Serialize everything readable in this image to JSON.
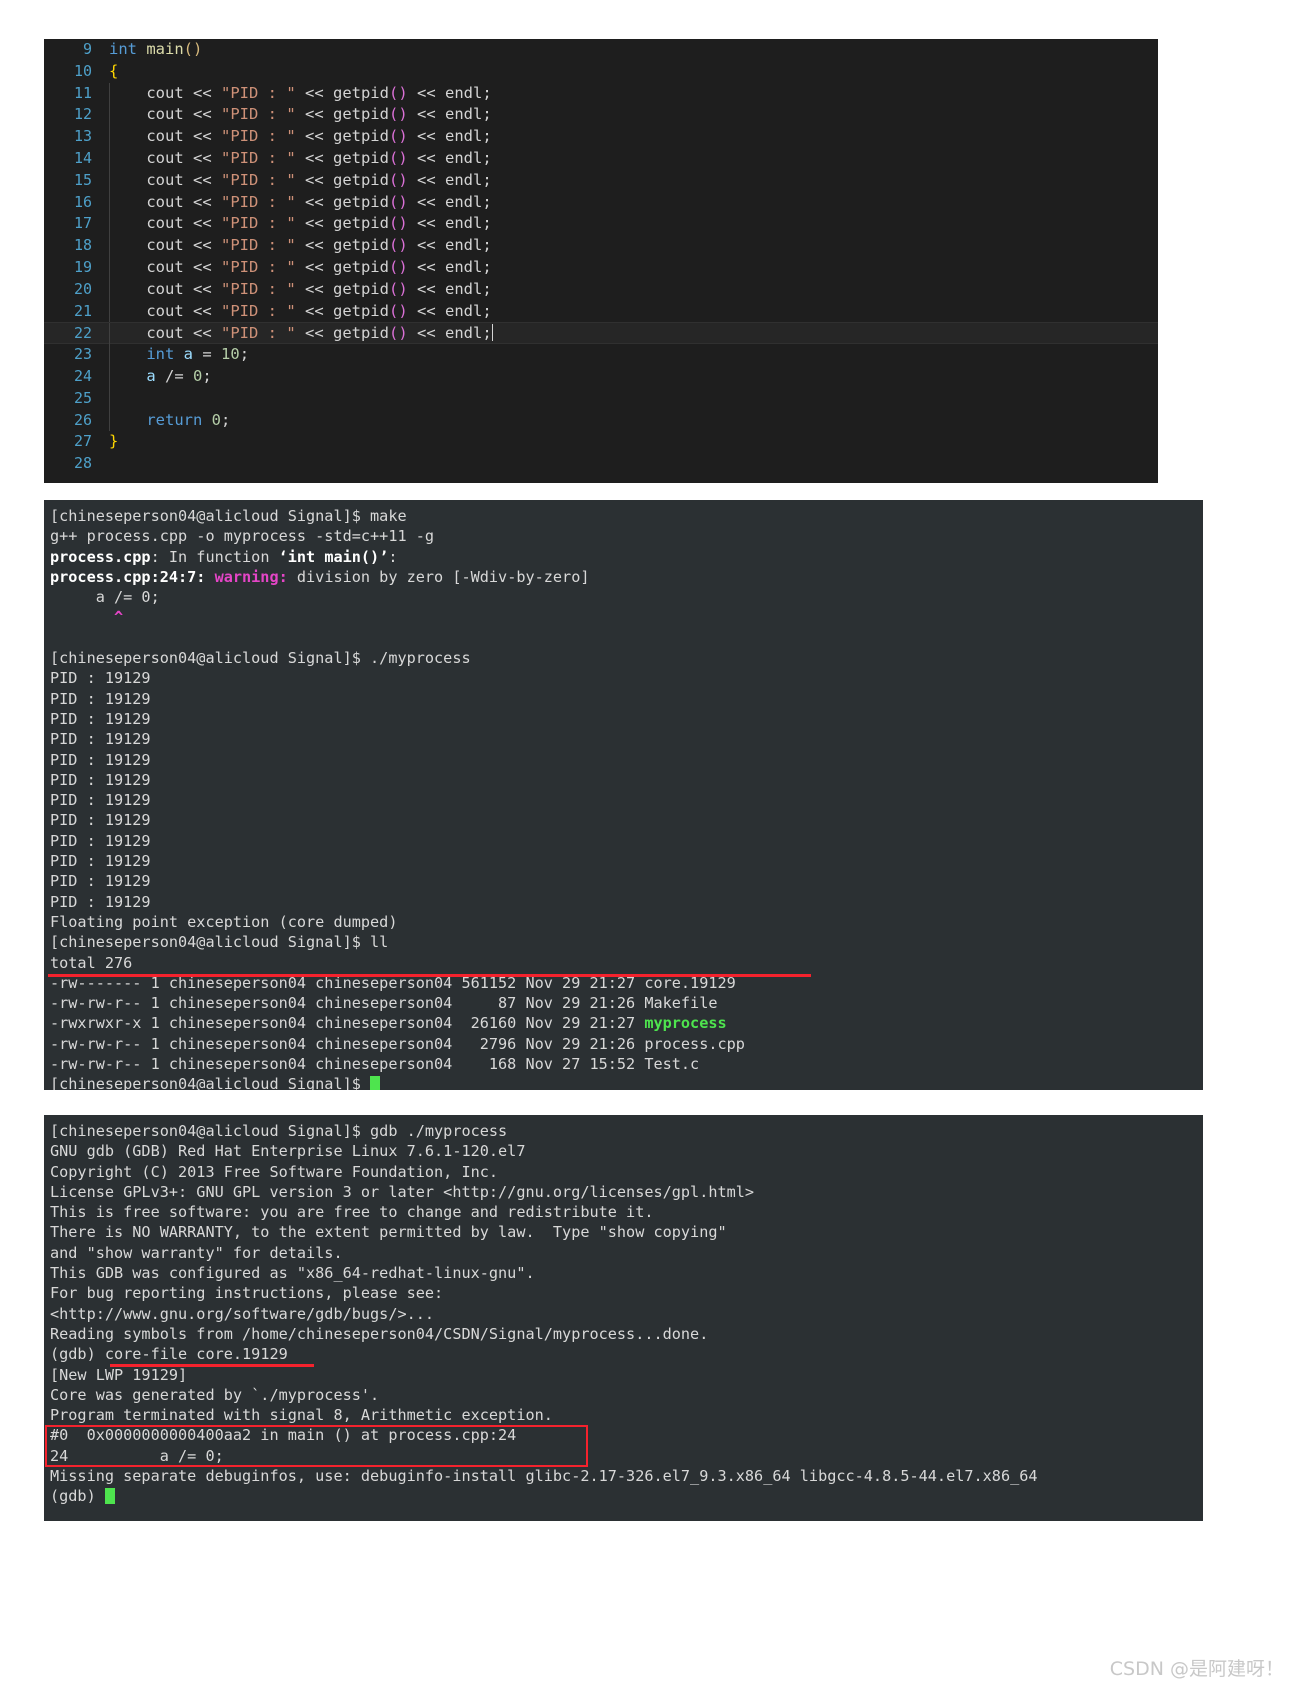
{
  "editor": {
    "name": "code-editor",
    "first_line": 9,
    "lines": [
      {
        "n": 9,
        "indent": 0,
        "tokens": [
          {
            "t": "int",
            "c": "kw"
          },
          {
            "t": " ",
            "c": "op"
          },
          {
            "t": "main",
            "c": "fn"
          },
          {
            "t": "(",
            "c": "paren"
          },
          {
            "t": ")",
            "c": "paren"
          }
        ]
      },
      {
        "n": 10,
        "indent": 0,
        "tokens": [
          {
            "t": "{",
            "c": "brace"
          }
        ]
      },
      {
        "n": 11,
        "indent": 1,
        "tokens": [
          {
            "t": "    cout ",
            "c": "op"
          },
          {
            "t": "<< ",
            "c": "op"
          },
          {
            "t": "\"PID : \"",
            "c": "str"
          },
          {
            "t": " << ",
            "c": "op"
          },
          {
            "t": "getpid",
            "c": "op"
          },
          {
            "t": "(",
            "c": "paren2"
          },
          {
            "t": ")",
            "c": "paren2"
          },
          {
            "t": " << endl;",
            "c": "op"
          }
        ]
      },
      {
        "n": 12,
        "indent": 1,
        "tokens": [
          {
            "t": "    cout ",
            "c": "op"
          },
          {
            "t": "<< ",
            "c": "op"
          },
          {
            "t": "\"PID : \"",
            "c": "str"
          },
          {
            "t": " << ",
            "c": "op"
          },
          {
            "t": "getpid",
            "c": "op"
          },
          {
            "t": "(",
            "c": "paren2"
          },
          {
            "t": ")",
            "c": "paren2"
          },
          {
            "t": " << endl;",
            "c": "op"
          }
        ]
      },
      {
        "n": 13,
        "indent": 1,
        "tokens": [
          {
            "t": "    cout ",
            "c": "op"
          },
          {
            "t": "<< ",
            "c": "op"
          },
          {
            "t": "\"PID : \"",
            "c": "str"
          },
          {
            "t": " << ",
            "c": "op"
          },
          {
            "t": "getpid",
            "c": "op"
          },
          {
            "t": "(",
            "c": "paren2"
          },
          {
            "t": ")",
            "c": "paren2"
          },
          {
            "t": " << endl;",
            "c": "op"
          }
        ]
      },
      {
        "n": 14,
        "indent": 1,
        "tokens": [
          {
            "t": "    cout ",
            "c": "op"
          },
          {
            "t": "<< ",
            "c": "op"
          },
          {
            "t": "\"PID : \"",
            "c": "str"
          },
          {
            "t": " << ",
            "c": "op"
          },
          {
            "t": "getpid",
            "c": "op"
          },
          {
            "t": "(",
            "c": "paren2"
          },
          {
            "t": ")",
            "c": "paren2"
          },
          {
            "t": " << endl;",
            "c": "op"
          }
        ]
      },
      {
        "n": 15,
        "indent": 1,
        "tokens": [
          {
            "t": "    cout ",
            "c": "op"
          },
          {
            "t": "<< ",
            "c": "op"
          },
          {
            "t": "\"PID : \"",
            "c": "str"
          },
          {
            "t": " << ",
            "c": "op"
          },
          {
            "t": "getpid",
            "c": "op"
          },
          {
            "t": "(",
            "c": "paren2"
          },
          {
            "t": ")",
            "c": "paren2"
          },
          {
            "t": " << endl;",
            "c": "op"
          }
        ]
      },
      {
        "n": 16,
        "indent": 1,
        "tokens": [
          {
            "t": "    cout ",
            "c": "op"
          },
          {
            "t": "<< ",
            "c": "op"
          },
          {
            "t": "\"PID : \"",
            "c": "str"
          },
          {
            "t": " << ",
            "c": "op"
          },
          {
            "t": "getpid",
            "c": "op"
          },
          {
            "t": "(",
            "c": "paren2"
          },
          {
            "t": ")",
            "c": "paren2"
          },
          {
            "t": " << endl;",
            "c": "op"
          }
        ]
      },
      {
        "n": 17,
        "indent": 1,
        "tokens": [
          {
            "t": "    cout ",
            "c": "op"
          },
          {
            "t": "<< ",
            "c": "op"
          },
          {
            "t": "\"PID : \"",
            "c": "str"
          },
          {
            "t": " << ",
            "c": "op"
          },
          {
            "t": "getpid",
            "c": "op"
          },
          {
            "t": "(",
            "c": "paren2"
          },
          {
            "t": ")",
            "c": "paren2"
          },
          {
            "t": " << endl;",
            "c": "op"
          }
        ]
      },
      {
        "n": 18,
        "indent": 1,
        "tokens": [
          {
            "t": "    cout ",
            "c": "op"
          },
          {
            "t": "<< ",
            "c": "op"
          },
          {
            "t": "\"PID : \"",
            "c": "str"
          },
          {
            "t": " << ",
            "c": "op"
          },
          {
            "t": "getpid",
            "c": "op"
          },
          {
            "t": "(",
            "c": "paren2"
          },
          {
            "t": ")",
            "c": "paren2"
          },
          {
            "t": " << endl;",
            "c": "op"
          }
        ]
      },
      {
        "n": 19,
        "indent": 1,
        "tokens": [
          {
            "t": "    cout ",
            "c": "op"
          },
          {
            "t": "<< ",
            "c": "op"
          },
          {
            "t": "\"PID : \"",
            "c": "str"
          },
          {
            "t": " << ",
            "c": "op"
          },
          {
            "t": "getpid",
            "c": "op"
          },
          {
            "t": "(",
            "c": "paren2"
          },
          {
            "t": ")",
            "c": "paren2"
          },
          {
            "t": " << endl;",
            "c": "op"
          }
        ]
      },
      {
        "n": 20,
        "indent": 1,
        "tokens": [
          {
            "t": "    cout ",
            "c": "op"
          },
          {
            "t": "<< ",
            "c": "op"
          },
          {
            "t": "\"PID : \"",
            "c": "str"
          },
          {
            "t": " << ",
            "c": "op"
          },
          {
            "t": "getpid",
            "c": "op"
          },
          {
            "t": "(",
            "c": "paren2"
          },
          {
            "t": ")",
            "c": "paren2"
          },
          {
            "t": " << endl;",
            "c": "op"
          }
        ]
      },
      {
        "n": 21,
        "indent": 1,
        "tokens": [
          {
            "t": "    cout ",
            "c": "op"
          },
          {
            "t": "<< ",
            "c": "op"
          },
          {
            "t": "\"PID : \"",
            "c": "str"
          },
          {
            "t": " << ",
            "c": "op"
          },
          {
            "t": "getpid",
            "c": "op"
          },
          {
            "t": "(",
            "c": "paren2"
          },
          {
            "t": ")",
            "c": "paren2"
          },
          {
            "t": " << endl;",
            "c": "op"
          }
        ]
      },
      {
        "n": 22,
        "indent": 1,
        "cursor": true,
        "highlight": true,
        "tokens": [
          {
            "t": "    cout ",
            "c": "op"
          },
          {
            "t": "<< ",
            "c": "op"
          },
          {
            "t": "\"PID : \"",
            "c": "str"
          },
          {
            "t": " << ",
            "c": "op"
          },
          {
            "t": "getpid",
            "c": "op"
          },
          {
            "t": "(",
            "c": "paren2"
          },
          {
            "t": ")",
            "c": "paren2"
          },
          {
            "t": " << endl;",
            "c": "op"
          }
        ]
      },
      {
        "n": 23,
        "indent": 1,
        "tokens": [
          {
            "t": "    ",
            "c": "op"
          },
          {
            "t": "int",
            "c": "kw"
          },
          {
            "t": " ",
            "c": "op"
          },
          {
            "t": "a",
            "c": "ident"
          },
          {
            "t": " = ",
            "c": "op"
          },
          {
            "t": "10",
            "c": "num"
          },
          {
            "t": ";",
            "c": "op"
          }
        ]
      },
      {
        "n": 24,
        "indent": 1,
        "tokens": [
          {
            "t": "    ",
            "c": "op"
          },
          {
            "t": "a",
            "c": "ident"
          },
          {
            "t": " /= ",
            "c": "op"
          },
          {
            "t": "0",
            "c": "num"
          },
          {
            "t": ";",
            "c": "op"
          }
        ]
      },
      {
        "n": 25,
        "indent": 1,
        "tokens": []
      },
      {
        "n": 26,
        "indent": 1,
        "tokens": [
          {
            "t": "    ",
            "c": "op"
          },
          {
            "t": "return",
            "c": "kw"
          },
          {
            "t": " ",
            "c": "op"
          },
          {
            "t": "0",
            "c": "num"
          },
          {
            "t": ";",
            "c": "op"
          }
        ]
      },
      {
        "n": 27,
        "indent": 0,
        "tokens": [
          {
            "t": "}",
            "c": "brace"
          }
        ]
      },
      {
        "n": 28,
        "indent": 0,
        "tokens": []
      }
    ]
  },
  "terminal_run": {
    "name": "terminal-run-output",
    "prompt": "[chineseperson04@alicloud Signal]$ ",
    "lines": [
      {
        "type": "prompt",
        "cmd": "make"
      },
      {
        "type": "plain",
        "text": "g++ process.cpp -o myprocess -std=c++11 -g"
      },
      {
        "type": "rich",
        "parts": [
          {
            "t": "process.cpp",
            "c": "c-bold"
          },
          {
            "t": ": In function ",
            "c": ""
          },
          {
            "t": "‘int main()’",
            "c": "c-bold"
          },
          {
            "t": ":",
            "c": ""
          }
        ]
      },
      {
        "type": "rich",
        "parts": [
          {
            "t": "process.cpp:24:7: ",
            "c": "c-bold"
          },
          {
            "t": "warning:",
            "c": "c-warn"
          },
          {
            "t": " division by zero [-Wdiv-by-zero]",
            "c": ""
          }
        ]
      },
      {
        "type": "plain",
        "text": "     a /= 0;"
      },
      {
        "type": "rich",
        "parts": [
          {
            "t": "       ",
            "c": ""
          },
          {
            "t": "^",
            "c": "c-warn"
          }
        ]
      },
      {
        "type": "plain",
        "text": ""
      },
      {
        "type": "prompt",
        "cmd": "./myprocess"
      },
      {
        "type": "plain",
        "text": "PID : 19129"
      },
      {
        "type": "plain",
        "text": "PID : 19129"
      },
      {
        "type": "plain",
        "text": "PID : 19129"
      },
      {
        "type": "plain",
        "text": "PID : 19129"
      },
      {
        "type": "plain",
        "text": "PID : 19129"
      },
      {
        "type": "plain",
        "text": "PID : 19129"
      },
      {
        "type": "plain",
        "text": "PID : 19129"
      },
      {
        "type": "plain",
        "text": "PID : 19129"
      },
      {
        "type": "plain",
        "text": "PID : 19129"
      },
      {
        "type": "plain",
        "text": "PID : 19129"
      },
      {
        "type": "plain",
        "text": "PID : 19129"
      },
      {
        "type": "plain",
        "text": "PID : 19129"
      },
      {
        "type": "plain",
        "text": "Floating point exception (core dumped)"
      },
      {
        "type": "prompt",
        "cmd": "ll"
      },
      {
        "type": "plain",
        "text": "total 276"
      },
      {
        "type": "plain",
        "text": "-rw------- 1 chineseperson04 chineseperson04 561152 Nov 29 21:27 core.19129"
      },
      {
        "type": "plain",
        "text": "-rw-rw-r-- 1 chineseperson04 chineseperson04     87 Nov 29 21:26 Makefile"
      },
      {
        "type": "rich",
        "parts": [
          {
            "t": "-rwxrwxr-x 1 chineseperson04 chineseperson04  26160 Nov 29 21:27 ",
            "c": ""
          },
          {
            "t": "myprocess",
            "c": "c-green"
          }
        ]
      },
      {
        "type": "plain",
        "text": "-rw-rw-r-- 1 chineseperson04 chineseperson04   2796 Nov 29 21:26 process.cpp"
      },
      {
        "type": "plain",
        "text": "-rw-rw-r-- 1 chineseperson04 chineseperson04    168 Nov 27 15:52 Test.c"
      },
      {
        "type": "prompt_cursor",
        "cmd": ""
      }
    ]
  },
  "terminal_gdb": {
    "name": "terminal-gdb-session",
    "prompt": "[chineseperson04@alicloud Signal]$ ",
    "gdb_prompt": "(gdb) ",
    "lines": [
      {
        "type": "prompt",
        "cmd": "gdb ./myprocess"
      },
      {
        "type": "plain",
        "text": "GNU gdb (GDB) Red Hat Enterprise Linux 7.6.1-120.el7"
      },
      {
        "type": "plain",
        "text": "Copyright (C) 2013 Free Software Foundation, Inc."
      },
      {
        "type": "plain",
        "text": "License GPLv3+: GNU GPL version 3 or later <http://gnu.org/licenses/gpl.html>"
      },
      {
        "type": "plain",
        "text": "This is free software: you are free to change and redistribute it."
      },
      {
        "type": "plain",
        "text": "There is NO WARRANTY, to the extent permitted by law.  Type \"show copying\""
      },
      {
        "type": "plain",
        "text": "and \"show warranty\" for details."
      },
      {
        "type": "plain",
        "text": "This GDB was configured as \"x86_64-redhat-linux-gnu\"."
      },
      {
        "type": "plain",
        "text": "For bug reporting instructions, please see:"
      },
      {
        "type": "plain",
        "text": "<http://www.gnu.org/software/gdb/bugs/>..."
      },
      {
        "type": "plain",
        "text": "Reading symbols from /home/chineseperson04/CSDN/Signal/myprocess...done."
      },
      {
        "type": "gdbcmd",
        "cmd": "core-file core.19129"
      },
      {
        "type": "plain",
        "text": "[New LWP 19129]"
      },
      {
        "type": "plain",
        "text": "Core was generated by `./myprocess'."
      },
      {
        "type": "plain",
        "text": "Program terminated with signal 8, Arithmetic exception."
      },
      {
        "type": "plain",
        "text": "#0  0x0000000000400aa2 in main () at process.cpp:24"
      },
      {
        "type": "plain",
        "text": "24          a /= 0;"
      },
      {
        "type": "plain",
        "text": "Missing separate debuginfos, use: debuginfo-install glibc-2.17-326.el7_9.3.x86_64 libgcc-4.8.5-44.el7.x86_64"
      },
      {
        "type": "gdb_cursor",
        "cmd": ""
      }
    ]
  },
  "annotations": {
    "core_file_underline": {
      "name": "red-underline-core-file-row",
      "color": "#f5222d"
    },
    "core_file_cmd_underline": {
      "name": "red-underline-core-file-command",
      "color": "#f5222d"
    },
    "frame_box": {
      "name": "red-box-crash-frame",
      "color": "#f5222d"
    }
  },
  "watermark": {
    "text": "CSDN @是阿建呀！",
    "color": "#c8c8c8"
  }
}
